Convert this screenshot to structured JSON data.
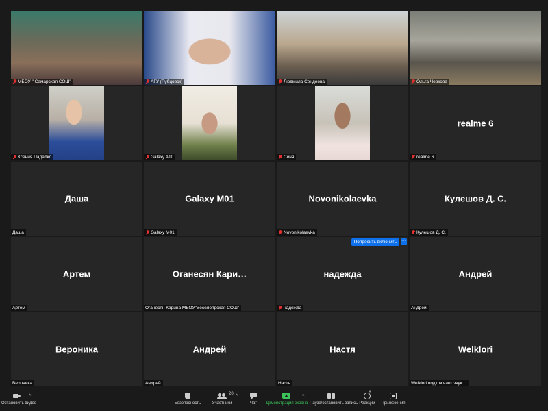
{
  "participants": [
    {
      "name": "МБОУ \" Самарская СОШ\"",
      "video": true,
      "muted": true,
      "scene": "scene1"
    },
    {
      "name": "АГУ (Рубцовск)",
      "video": true,
      "muted": true,
      "scene": "scene2",
      "active": true
    },
    {
      "name": "Людмила Сендеева",
      "video": true,
      "muted": true,
      "scene": "scene3"
    },
    {
      "name": "Ольга Черкова",
      "video": true,
      "muted": true,
      "scene": "scene4"
    },
    {
      "name": "Ксения Падалко",
      "video": true,
      "muted": true,
      "scene": "scene5",
      "narrow": true
    },
    {
      "name": "Galaxy A10",
      "video": true,
      "muted": true,
      "scene": "scene6",
      "narrow": true
    },
    {
      "name": "Соня",
      "video": true,
      "muted": true,
      "scene": "scene7",
      "narrow": true
    },
    {
      "name": "realme 6",
      "display": "realme 6",
      "video": false,
      "muted": true
    },
    {
      "name": "Даша",
      "display": "Даша",
      "video": false,
      "muted": false
    },
    {
      "name": "Galaxy M01",
      "display": "Galaxy M01",
      "video": false,
      "muted": true
    },
    {
      "name": "Novonikolaevka",
      "display": "Novonikolaevka",
      "video": false,
      "muted": true
    },
    {
      "name": "Кулешов Д. С.",
      "display": "Кулешов Д. С.",
      "video": false,
      "muted": true
    },
    {
      "name": "Артем",
      "display": "Артем",
      "video": false,
      "muted": false
    },
    {
      "name": "Оганесян Карина МБОУ\"Веселоярская СОШ\"",
      "display": "Оганесян  Кари…",
      "video": false,
      "muted": false
    },
    {
      "name": "надежда",
      "display": "надежда",
      "video": false,
      "muted": true,
      "ask_unmute": true
    },
    {
      "name": "Андрей",
      "display": "Андрей",
      "video": false,
      "muted": false
    },
    {
      "name": "Вероника",
      "display": "Вероника",
      "video": false,
      "muted": false
    },
    {
      "name": "Андрей",
      "display": "Андрей",
      "video": false,
      "muted": false
    },
    {
      "name": "Настя",
      "display": "Настя",
      "video": false,
      "muted": false
    },
    {
      "name": "Welklori подключает звук ...",
      "display": "Welklori",
      "video": false,
      "muted": false
    }
  ],
  "tile_actions": {
    "ask_unmute_label": "Попросить включить",
    "more_label": "···"
  },
  "toolbar": {
    "stop_video": "Остановить видео",
    "security": "Безопасность",
    "participants": "Участники",
    "participants_count": "20",
    "chat": "Чат",
    "share_screen": "Демонстрация экрана",
    "pause_recording": "Пауза/остановить запись",
    "reactions": "Реакции",
    "apps": "Приложения",
    "caret": "^"
  },
  "colors": {
    "active_speaker": "#d6e24a",
    "accent_blue": "#0e71eb",
    "share_green": "#3bc45a",
    "muted_red": "#e03131"
  }
}
